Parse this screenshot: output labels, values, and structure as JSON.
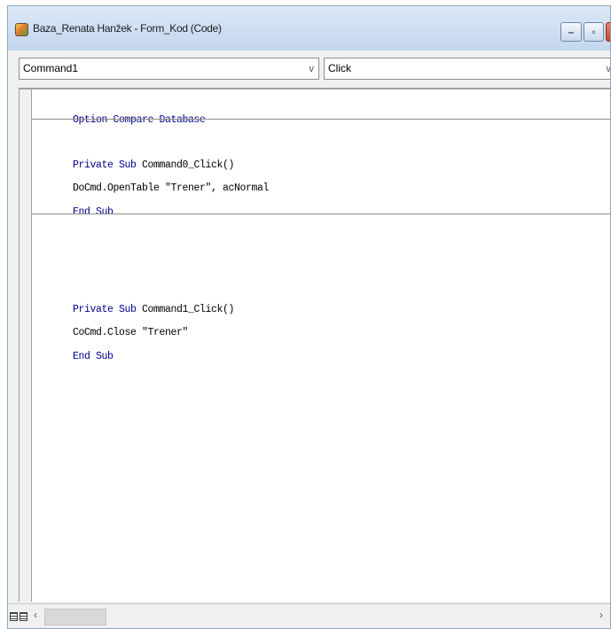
{
  "window": {
    "title": "Baza_Renata Hanžek - Form_Kod (Code)"
  },
  "toolbar": {
    "object_value": "Command1",
    "procedure_value": "Click",
    "arrow_glyph": "v"
  },
  "code": {
    "lines": [
      {
        "kw": "Option Compare Database",
        "text": ""
      },
      {
        "kw": "Private Sub",
        "text": " Command0_Click()"
      },
      {
        "kw": "",
        "text": "DoCmd.OpenTable \"Trener\", acNormal"
      },
      {
        "kw": "End Sub",
        "text": ""
      },
      {
        "kw": "Private Sub",
        "text": " Command1_Click()"
      },
      {
        "kw": "",
        "text": "CoCmd.Close \"Trener\""
      },
      {
        "kw": "End Sub",
        "text": ""
      }
    ]
  },
  "statusbar": {
    "scroll_left_glyph": "‹",
    "scroll_right_glyph": "›"
  },
  "colors": {
    "keyword": "#00008b",
    "title_gradient_top": "#dbe8f7",
    "close_button": "#c24a2d"
  },
  "icons": [
    "access-form-icon",
    "minimize-icon",
    "maximize-icon",
    "close-icon",
    "chevron-down-icon",
    "procedure-view-icon",
    "full-module-view-icon"
  ]
}
